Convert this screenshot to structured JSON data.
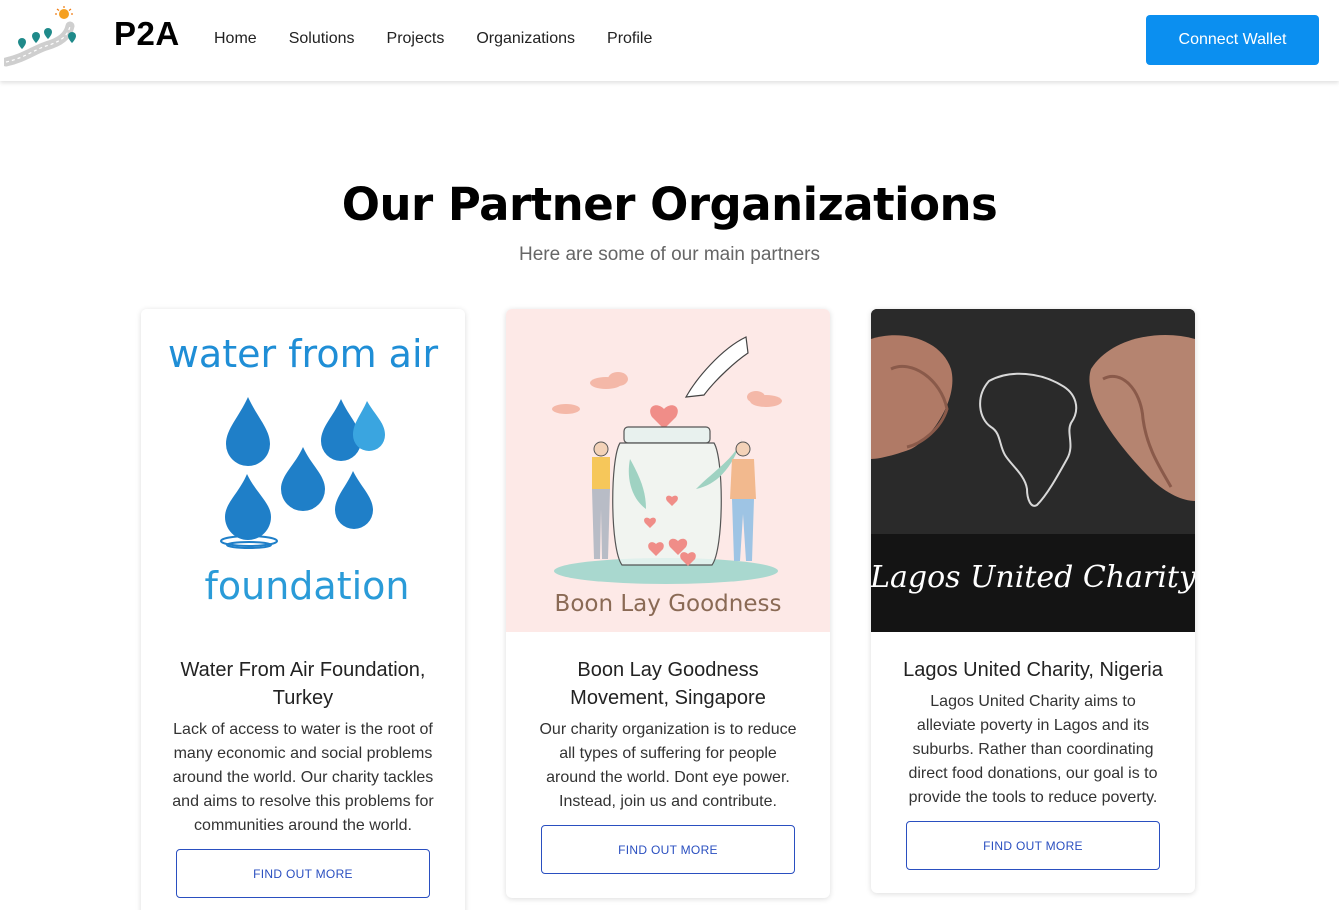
{
  "navbar": {
    "brand": "P2A",
    "links": [
      "Home",
      "Solutions",
      "Projects",
      "Organizations",
      "Profile"
    ],
    "connect_label": "Connect Wallet"
  },
  "section": {
    "title": "Our Partner Organizations",
    "subtitle": "Here are some of our main partners"
  },
  "cards": [
    {
      "image_text_top": "water from air",
      "image_text_bottom": "foundation",
      "title": "Water From Air Foundation, Turkey",
      "text": "Lack of access to water is the root of many economic and social problems around the world. Our charity tackles and aims to resolve this problems for communities around the world.",
      "button": "FIND OUT MORE"
    },
    {
      "image_text": "Boon Lay Goodness",
      "title": "Boon Lay Goodness Movement, Singapore",
      "text": "Our charity organization is to reduce all types of suffering for people around the world. Dont eye power. Instead, join us and contribute.",
      "button": "FIND OUT MORE"
    },
    {
      "image_text": "Lagos United Charity",
      "title": "Lagos United Charity, Nigeria",
      "text": "Lagos United Charity aims to alleviate poverty in Lagos and its suburbs. Rather than coordinating direct food donations, our goal is to provide the tools to reduce poverty.",
      "button": "FIND OUT MORE"
    }
  ],
  "colors": {
    "accent": "#0b8ff0",
    "button_outline": "#2a4fc0",
    "water_blue": "#1f8ed6",
    "boon_bg": "#fde9e7",
    "lagos_bg": "#1c1c1c"
  }
}
